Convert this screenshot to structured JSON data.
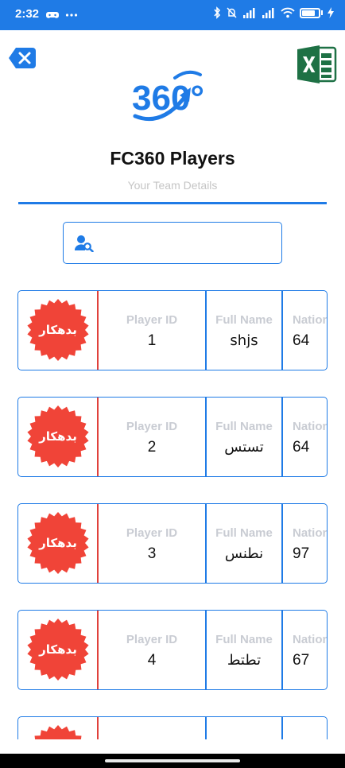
{
  "status_bar": {
    "time": "2:32",
    "left_icons": [
      "gamepad-icon",
      "more-icon"
    ],
    "right_icons": [
      "bluetooth-icon",
      "mute-icon",
      "signal-icon",
      "signal-icon",
      "wifi-icon",
      "battery-icon",
      "charging-icon"
    ]
  },
  "header": {
    "title": "FC360 Players",
    "subtitle": "Your Team Details",
    "logo_text": "360°"
  },
  "search": {
    "value": "",
    "placeholder": ""
  },
  "columns": {
    "player_id": "Player ID",
    "full_name": "Full Name",
    "nationality": "Nation"
  },
  "players": [
    {
      "badge": "بدهکار",
      "player_id": "1",
      "full_name": "shjs",
      "nationality": "64"
    },
    {
      "badge": "بدهکار",
      "player_id": "2",
      "full_name": "تستس",
      "nationality": "64"
    },
    {
      "badge": "بدهکار",
      "player_id": "3",
      "full_name": "نطنس",
      "nationality": "97"
    },
    {
      "badge": "بدهکار",
      "player_id": "4",
      "full_name": "تطتط",
      "nationality": "67"
    },
    {
      "badge": "",
      "player_id": "",
      "full_name": "",
      "nationality": ""
    }
  ],
  "colors": {
    "primary": "#1f7be6",
    "badge": "#f04438",
    "divider_red": "#e0413c",
    "label_gray": "#c9ccd3",
    "excel_green": "#1e7145"
  }
}
